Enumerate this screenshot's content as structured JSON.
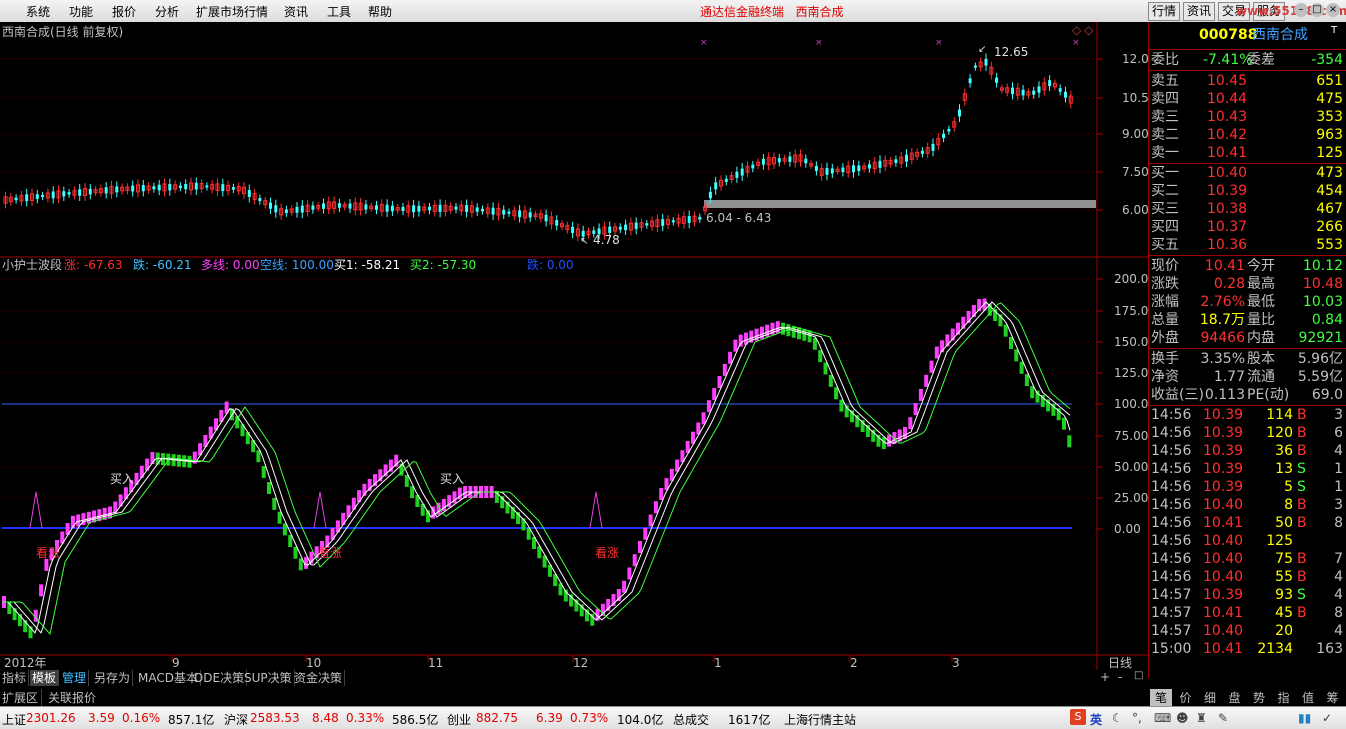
{
  "menu": {
    "items": [
      "系统",
      "功能",
      "报价",
      "分析",
      "扩展市场行情",
      "资讯",
      "工具",
      "帮助"
    ],
    "title": "通达信金融终端",
    "stock_title": "西南合成"
  },
  "right_tabs": [
    "行情",
    "资讯",
    "交易",
    "服务"
  ],
  "watermark": "www.55188.com",
  "chart": {
    "main_title": "西南合成(日线 前复权)",
    "price_ticks": [
      "12.00",
      "10.50",
      "9.00",
      "7.50",
      "6.00"
    ],
    "high_label": "12.65",
    "low_label": "4.78",
    "range_label": "6.04 - 6.43",
    "ind_title": "小护士波段",
    "ind_vals": [
      {
        "label": "涨: -67.63",
        "color": "#ff3030"
      },
      {
        "label": "跌: -60.21",
        "color": "#40c0ff"
      },
      {
        "label": "多线: 0.00",
        "color": "#ff40ff"
      },
      {
        "label": "空线: 100.00",
        "color": "#40a0ff"
      },
      {
        "label": "买1: -58.21",
        "color": "#ffffff"
      },
      {
        "label": "买2: -57.30",
        "color": "#40ff40"
      },
      {
        "label": "跌: 0.00",
        "color": "#2050ff"
      }
    ],
    "ind_ticks": [
      "200.0",
      "175.0",
      "150.0",
      "125.0",
      "100.0",
      "75.00",
      "50.00",
      "25.00",
      "0.00"
    ],
    "annot_buy": [
      "买入",
      "买入"
    ],
    "annot_up": [
      "看涨",
      "看涨",
      "看涨"
    ],
    "axis_labels": [
      "2012年",
      "9",
      "10",
      "11",
      "12",
      "1",
      "2",
      "3"
    ],
    "period": "日线"
  },
  "quote": {
    "code": "000788",
    "name": "西南合成",
    "wb_label": "委比",
    "wb_val": "-7.41%",
    "wc_label": "委差",
    "wc_val": "-354",
    "sells": [
      [
        "卖五",
        "10.45",
        "651"
      ],
      [
        "卖四",
        "10.44",
        "475"
      ],
      [
        "卖三",
        "10.43",
        "353"
      ],
      [
        "卖二",
        "10.42",
        "963"
      ],
      [
        "卖一",
        "10.41",
        "125"
      ]
    ],
    "buys": [
      [
        "买一",
        "10.40",
        "473"
      ],
      [
        "买二",
        "10.39",
        "454"
      ],
      [
        "买三",
        "10.38",
        "467"
      ],
      [
        "买四",
        "10.37",
        "266"
      ],
      [
        "买五",
        "10.36",
        "553"
      ]
    ],
    "stats": [
      [
        "现价",
        "10.41",
        "今开",
        "10.12"
      ],
      [
        "涨跌",
        "0.28",
        "最高",
        "10.48"
      ],
      [
        "涨幅",
        "2.76%",
        "最低",
        "10.03"
      ],
      [
        "总量",
        "18.7万",
        "量比",
        "0.84"
      ],
      [
        "外盘",
        "94466",
        "内盘",
        "92921"
      ]
    ],
    "stats2": [
      [
        "换手",
        "3.35%",
        "股本",
        "5.96亿"
      ],
      [
        "净资",
        "1.77",
        "流通",
        "5.59亿"
      ],
      [
        "收益(三)",
        "0.113",
        "PE(动)",
        "69.0"
      ]
    ],
    "ticks": [
      [
        "14:56",
        "10.39",
        "114",
        "B",
        "3"
      ],
      [
        "14:56",
        "10.39",
        "120",
        "B",
        "6"
      ],
      [
        "14:56",
        "10.39",
        "36",
        "B",
        "4"
      ],
      [
        "14:56",
        "10.39",
        "13",
        "S",
        "1"
      ],
      [
        "14:56",
        "10.39",
        "5",
        "S",
        "1"
      ],
      [
        "14:56",
        "10.40",
        "8",
        "B",
        "3"
      ],
      [
        "14:56",
        "10.41",
        "50",
        "B",
        "8"
      ],
      [
        "14:56",
        "10.40",
        "125",
        "",
        ""
      ],
      [
        "14:56",
        "10.40",
        "75",
        "B",
        "7"
      ],
      [
        "14:56",
        "10.40",
        "55",
        "B",
        "4"
      ],
      [
        "14:57",
        "10.39",
        "93",
        "S",
        "4"
      ],
      [
        "14:57",
        "10.41",
        "45",
        "B",
        "8"
      ],
      [
        "14:57",
        "10.40",
        "20",
        "",
        "4"
      ],
      [
        "15:00",
        "10.41",
        "2134",
        "",
        "163"
      ]
    ],
    "bottom_tabs": [
      "笔",
      "价",
      "细",
      "盘",
      "势",
      "指",
      "值",
      "筹"
    ]
  },
  "bottom_tabs": [
    "指标",
    "模板",
    "管理",
    "另存为",
    "MACD基本",
    "DDE决策",
    "SUP决策",
    "资金决策"
  ],
  "ext_tabs": [
    "扩展区",
    "关联报价"
  ],
  "status": {
    "sh_label": "上证",
    "sh_val": "2301.26",
    "sh_chg": "3.59",
    "sh_pct": "0.16%",
    "sh_amt": "857.1亿",
    "sz_label": "沪深",
    "sz_val": "2583.53",
    "sz_chg": "8.48",
    "sz_pct": "0.33%",
    "sz_amt": "586.5亿",
    "cy_label": "创业",
    "cy_val": "882.75",
    "cy_chg": "6.39",
    "cy_pct": "0.73%",
    "cy_amt": "104.0亿",
    "total_label": "总成交",
    "total_val": "1617亿",
    "server": "上海行情主站",
    "ime": "英"
  }
}
